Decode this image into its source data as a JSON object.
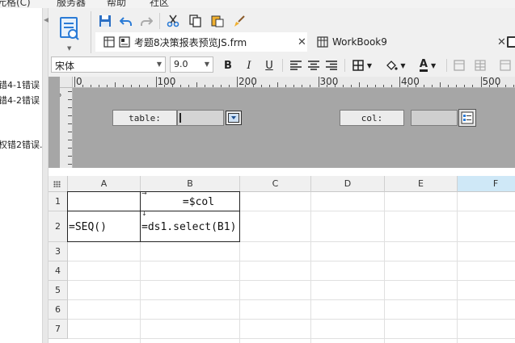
{
  "menubar": {
    "items": [
      "元格(C)",
      "服务器",
      "帮助",
      "社区"
    ]
  },
  "left_panel": {
    "items": [
      "错4-1错误",
      "错4-2错误",
      "权错2错误."
    ]
  },
  "tabs": [
    {
      "label": "考题8决策报表预览JS.frm",
      "active": true
    },
    {
      "label": "WorkBook9",
      "active": false
    }
  ],
  "format_bar": {
    "font_family_value": "宋体",
    "font_size_value": "9.0",
    "bold_label": "B",
    "italic_label": "I",
    "underline_label": "U",
    "font_color_label": "A"
  },
  "ruler": {
    "labels": [
      "0",
      "100",
      "200",
      "300",
      "400",
      "500"
    ],
    "vertical_label": "0"
  },
  "parameter_pane": {
    "table_label": "table:",
    "col_label": "col:"
  },
  "sheet": {
    "columns": [
      "A",
      "B",
      "C",
      "D",
      "E",
      "F"
    ],
    "rows": [
      "1",
      "2",
      "3",
      "4",
      "5",
      "6",
      "7"
    ],
    "cells": {
      "B1": "=$col",
      "A2": "=SEQ()",
      "B2": "=ds1.select(B1)"
    },
    "selected_column": "F"
  },
  "colors": {
    "design_bg": "#a6a6a6",
    "toolbar_bg": "#f0f0f0",
    "selected_header": "#cfe8f7",
    "accent_blue": "#2b7bd6"
  }
}
